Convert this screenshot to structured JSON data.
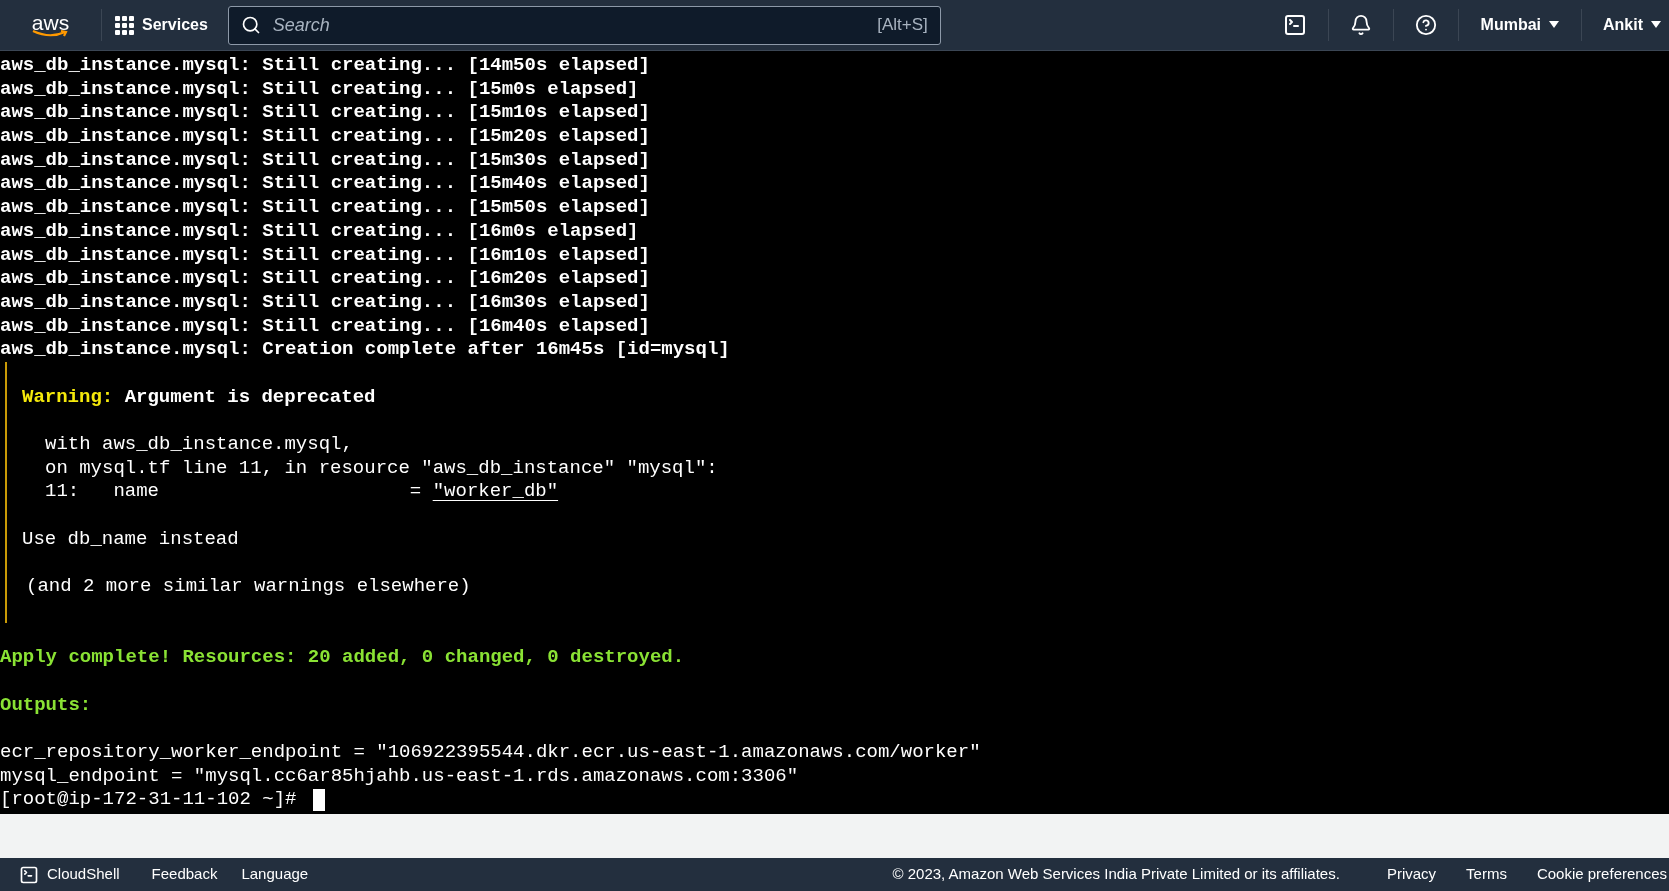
{
  "nav": {
    "logo": "aws",
    "services": "Services",
    "search": {
      "placeholder": "Search",
      "shortcut": "[Alt+S]"
    },
    "region": "Mumbai",
    "account": "Ankit"
  },
  "terminal": {
    "progress": [
      "aws_db_instance.mysql: Still creating... [14m50s elapsed]",
      "aws_db_instance.mysql: Still creating... [15m0s elapsed]",
      "aws_db_instance.mysql: Still creating... [15m10s elapsed]",
      "aws_db_instance.mysql: Still creating... [15m20s elapsed]",
      "aws_db_instance.mysql: Still creating... [15m30s elapsed]",
      "aws_db_instance.mysql: Still creating... [15m40s elapsed]",
      "aws_db_instance.mysql: Still creating... [15m50s elapsed]",
      "aws_db_instance.mysql: Still creating... [16m0s elapsed]",
      "aws_db_instance.mysql: Still creating... [16m10s elapsed]",
      "aws_db_instance.mysql: Still creating... [16m20s elapsed]",
      "aws_db_instance.mysql: Still creating... [16m30s elapsed]",
      "aws_db_instance.mysql: Still creating... [16m40s elapsed]",
      "aws_db_instance.mysql: Creation complete after 16m45s [id=mysql]"
    ],
    "warning": {
      "label": "Warning:",
      "title": "Argument is deprecated",
      "details": [
        "with aws_db_instance.mysql,",
        "on mysql.tf line 11, in resource \"aws_db_instance\" \"mysql\":"
      ],
      "code_line": {
        "prefix": "11:   name                      = ",
        "value": "\"worker_db\""
      },
      "advice": "Use db_name instead",
      "more": "(and 2 more similar warnings elsewhere)"
    },
    "summary": "Apply complete! Resources: 20 added, 0 changed, 0 destroyed.",
    "outputs_heading": "Outputs:",
    "outputs": [
      "ecr_repository_worker_endpoint = \"106922395544.dkr.ecr.us-east-1.amazonaws.com/worker\"",
      "mysql_endpoint = \"mysql.cc6ar85hjahb.us-east-1.rds.amazonaws.com:3306\""
    ],
    "prompt": "[root@ip-172-31-11-102 ~]#"
  },
  "footer": {
    "cloudshell": "CloudShell",
    "links_left": [
      "Feedback",
      "Language"
    ],
    "copyright": "© 2023, Amazon Web Services India Private Limited or its affiliates.",
    "links_right": [
      "Privacy",
      "Terms",
      "Cookie preferences"
    ]
  }
}
